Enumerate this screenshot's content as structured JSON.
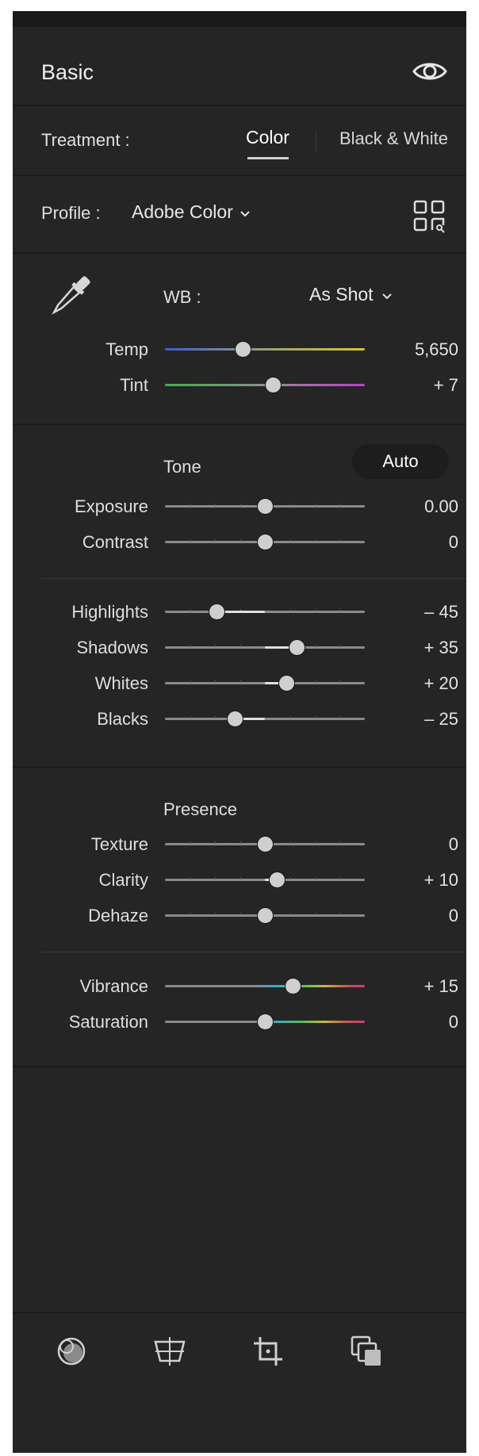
{
  "header": {
    "title": "Basic",
    "visibility_icon": "eye-icon"
  },
  "treatment": {
    "label": "Treatment :",
    "tabs": [
      "Color",
      "Black & White"
    ],
    "selected": "Color"
  },
  "profile": {
    "label": "Profile :",
    "value": "Adobe Color",
    "browse_icon": "profile-grid-icon"
  },
  "wb": {
    "picker_icon": "eyedropper-icon",
    "label": "WB :",
    "value": "As Shot",
    "sliders": [
      {
        "label": "Temp",
        "value": "5,650",
        "position": 0.39,
        "track_colors": [
          "#3a5bd9",
          "#d8c428"
        ]
      },
      {
        "label": "Tint",
        "value": "+ 7",
        "position": 0.54,
        "track_colors": [
          "#3fb04a",
          "#c23ccf"
        ]
      }
    ]
  },
  "tone": {
    "label": "Tone",
    "auto_label": "Auto",
    "sliders_top": [
      {
        "label": "Exposure",
        "value": "0.00",
        "position": 0.5
      },
      {
        "label": "Contrast",
        "value": "0",
        "position": 0.5
      }
    ],
    "sliders_bottom": [
      {
        "label": "Highlights",
        "value": "– 45",
        "position": 0.26
      },
      {
        "label": "Shadows",
        "value": "+ 35",
        "position": 0.66
      },
      {
        "label": "Whites",
        "value": "+ 20",
        "position": 0.61
      },
      {
        "label": "Blacks",
        "value": "– 25",
        "position": 0.35
      }
    ]
  },
  "presence": {
    "label": "Presence",
    "sliders_top": [
      {
        "label": "Texture",
        "value": "0",
        "position": 0.5
      },
      {
        "label": "Clarity",
        "value": "+ 10",
        "position": 0.56
      },
      {
        "label": "Dehaze",
        "value": "0",
        "position": 0.5
      }
    ],
    "sliders_bottom": [
      {
        "label": "Vibrance",
        "value": "+ 15",
        "position": 0.64
      },
      {
        "label": "Saturation",
        "value": "0",
        "position": 0.5
      }
    ]
  },
  "toolbar": {
    "icons": [
      "color-mixer-icon",
      "geometry-icon",
      "crop-icon",
      "copy-settings-icon"
    ]
  },
  "colors": {
    "panel_bg": "#252525",
    "accent_text": "#ffffff",
    "thumb": "#cfcfcf"
  }
}
